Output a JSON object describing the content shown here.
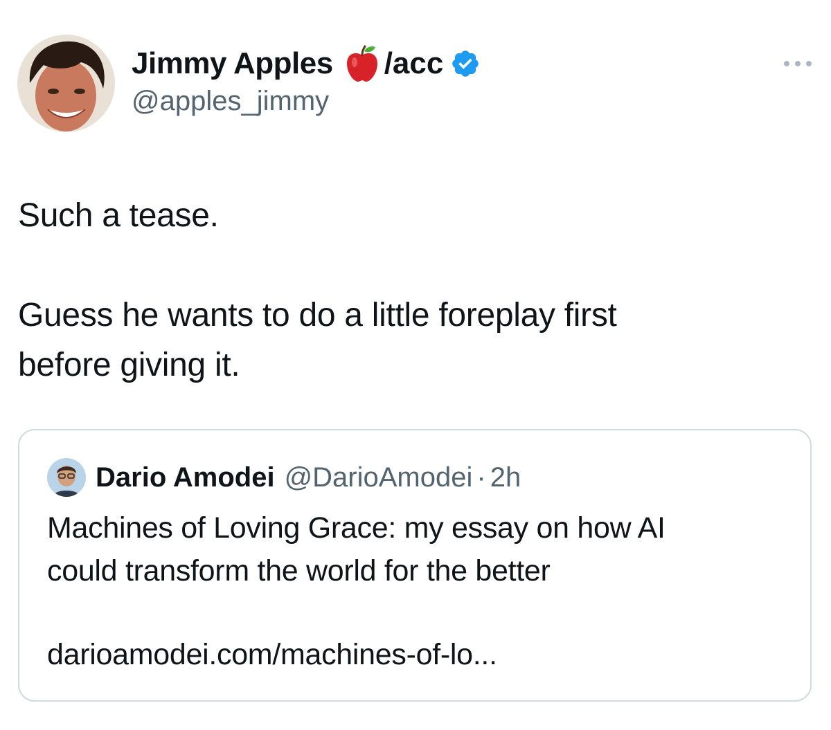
{
  "tweet": {
    "author": {
      "display_name": "Jimmy Apples",
      "name_suffix": "/acc",
      "handle": "@apples_jimmy",
      "avatar_icon": "profile-photo",
      "emoji_icon": "red-apple-icon",
      "verified_icon": "verified-badge-icon"
    },
    "more_icon": "more-options-icon",
    "text": {
      "line1": "Such a tease.",
      "line2": "Guess he wants to do a little foreplay first before giving it."
    },
    "quoted": {
      "display_name": "Dario Amodei",
      "handle": "@DarioAmodei",
      "separator": "·",
      "time": "2h",
      "text": "Machines of Loving Grace: my essay on how AI could transform the world for the better",
      "link": "darioamodei.com/machines-of-lo..."
    }
  },
  "colors": {
    "text_primary": "#0f1419",
    "text_secondary": "#536471",
    "verified_blue": "#1d9bf0",
    "border": "#cfd9de"
  }
}
